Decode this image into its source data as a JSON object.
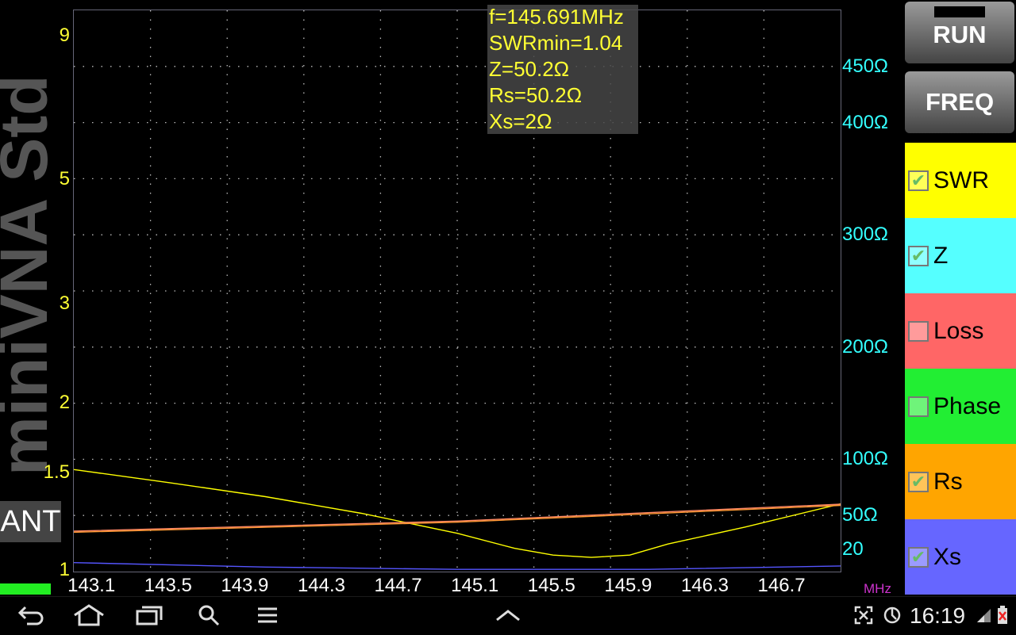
{
  "app": {
    "name": "miniVNA Std",
    "port_label": "ANT"
  },
  "readout": {
    "frequency": "f=145.691MHz",
    "swr_min": "SWRmin=1.04",
    "z": "Z=50.2Ω",
    "rs": "Rs=50.2Ω",
    "xs": "Xs=2Ω"
  },
  "buttons": {
    "run": "RUN",
    "freq": "FREQ"
  },
  "legend": [
    {
      "label": "SWR",
      "checked": true,
      "color": "#ffff00"
    },
    {
      "label": "Z",
      "checked": true,
      "color": "#55ffff"
    },
    {
      "label": "Loss",
      "checked": false,
      "color": "#ff6666"
    },
    {
      "label": "Phase",
      "checked": false,
      "color": "#22ee33"
    },
    {
      "label": "Rs",
      "checked": true,
      "color": "#ffa500"
    },
    {
      "label": "Xs",
      "checked": true,
      "color": "#6666ff"
    }
  ],
  "status_bar": {
    "time": "16:19"
  },
  "icons": [
    "back-icon",
    "home-icon",
    "recent-apps-icon",
    "search-icon",
    "menu-icon",
    "up-chevron-icon",
    "screenshot-icon",
    "sync-icon",
    "signal-icon",
    "battery-icon"
  ],
  "chart_data": {
    "type": "line",
    "x_unit": "MHz",
    "x_range": [
      143.0,
      147.0
    ],
    "x_ticks": [
      "143.1",
      "143.5",
      "143.9",
      "144.3",
      "144.7",
      "145.1",
      "145.5",
      "145.9",
      "146.3",
      "146.7"
    ],
    "left_axis": {
      "scale": "swr",
      "ticks": [
        "9",
        "5",
        "3",
        "2",
        "1.5",
        "1"
      ],
      "color": "#ffff33"
    },
    "right_axis": {
      "ticks": [
        "450Ω",
        "400Ω",
        "300Ω",
        "200Ω",
        "100Ω",
        "50Ω",
        "20"
      ],
      "color": "#33ffff"
    },
    "series": [
      {
        "name": "SWR",
        "color": "#ffff00",
        "axis": "left",
        "x": [
          143.0,
          143.5,
          144.0,
          144.5,
          145.0,
          145.3,
          145.5,
          145.7,
          145.9,
          146.1,
          146.5,
          147.0
        ],
        "y": [
          1.52,
          1.44,
          1.36,
          1.27,
          1.17,
          1.1,
          1.07,
          1.06,
          1.07,
          1.12,
          1.2,
          1.32
        ]
      },
      {
        "name": "Z",
        "color": "#ff8866",
        "axis": "right",
        "x": [
          143.0,
          145.0,
          147.0
        ],
        "y": [
          36,
          45,
          60
        ]
      },
      {
        "name": "Rs",
        "color": "#ff9933",
        "axis": "right",
        "x": [
          143.0,
          145.0,
          147.0
        ],
        "y": [
          35,
          44,
          59
        ]
      },
      {
        "name": "Xs",
        "color": "#5555ff",
        "axis": "right",
        "x": [
          143.0,
          144.0,
          145.0,
          146.0,
          147.0
        ],
        "y": [
          8,
          4,
          2,
          2,
          5
        ]
      }
    ]
  }
}
